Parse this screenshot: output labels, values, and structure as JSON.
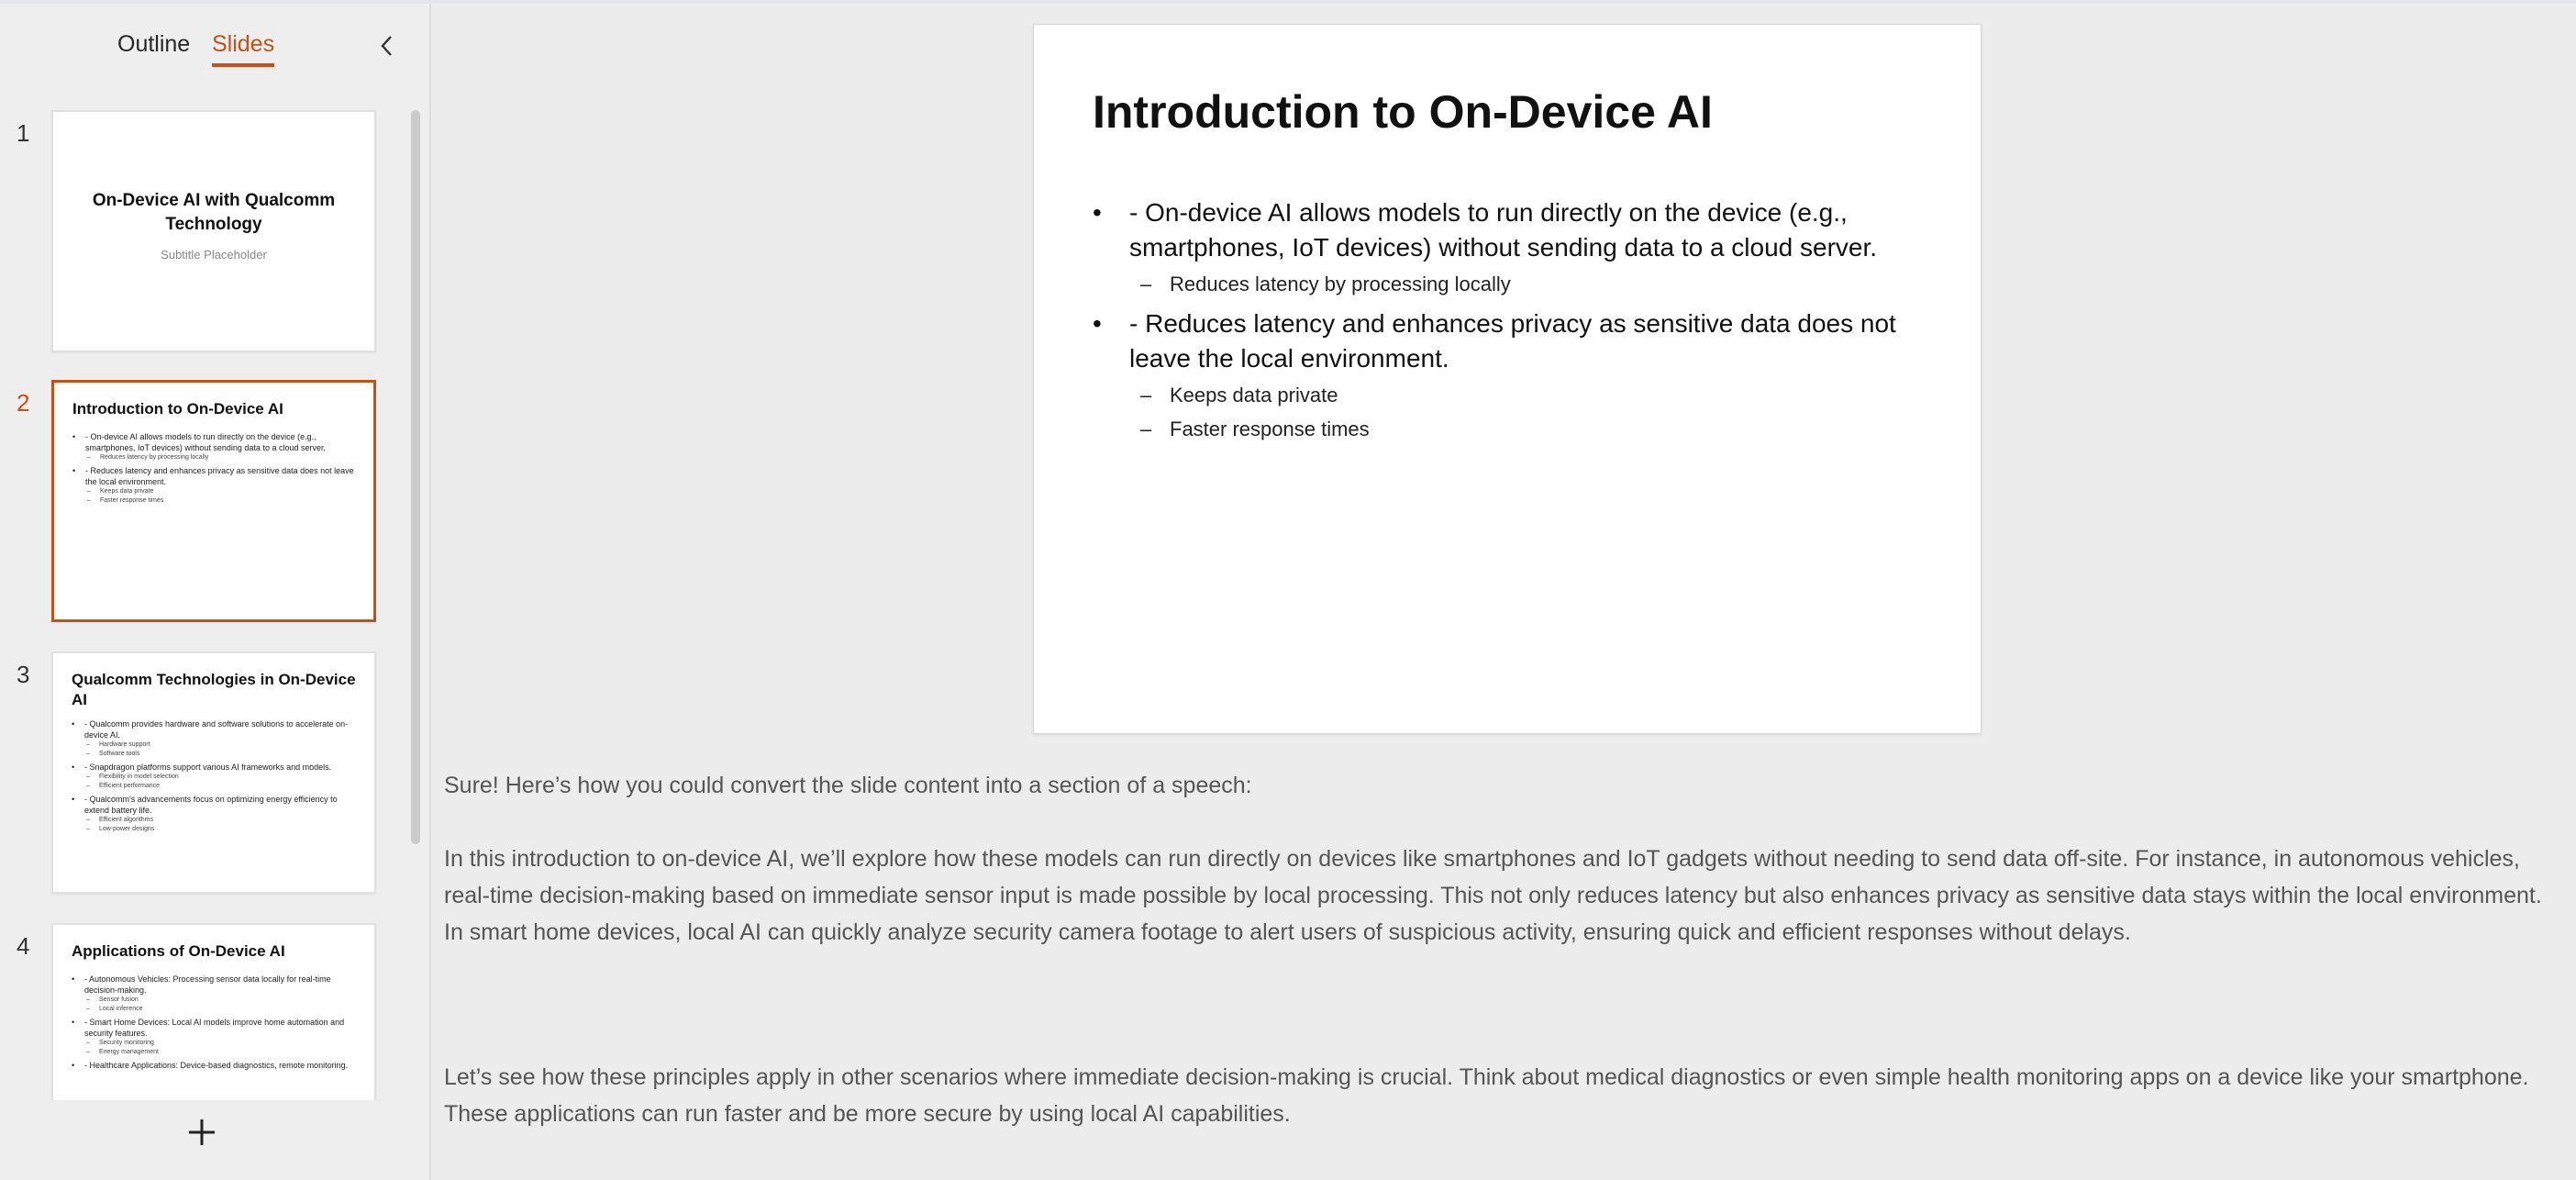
{
  "panel": {
    "tabs": [
      {
        "label": "Outline"
      },
      {
        "label": "Slides"
      }
    ]
  },
  "thumbnails": [
    {
      "num": "1",
      "title": "On-Device AI with Qualcomm Technology",
      "subtitle": "Subtitle Placeholder"
    },
    {
      "num": "2",
      "title": "Introduction to On-Device AI",
      "items": [
        {
          "type": "b",
          "text": "- On-device AI allows models to run directly on the device (e.g., smartphones, IoT devices) without sending data to a cloud server."
        },
        {
          "type": "s",
          "text": "Reduces latency by processing locally"
        },
        {
          "type": "b",
          "text": "- Reduces latency and enhances privacy as sensitive data does not leave the local environment."
        },
        {
          "type": "s",
          "text": "Keeps data private"
        },
        {
          "type": "s",
          "text": "Faster response times"
        }
      ]
    },
    {
      "num": "3",
      "title": "Qualcomm Technologies in On-Device AI",
      "items": [
        {
          "type": "b",
          "text": "- Qualcomm provides hardware and software solutions to accelerate on-device AI."
        },
        {
          "type": "s",
          "text": "Hardware support"
        },
        {
          "type": "s",
          "text": "Software tools"
        },
        {
          "type": "b",
          "text": "- Snapdragon platforms support various AI frameworks and models."
        },
        {
          "type": "s",
          "text": "Flexibility in model selection"
        },
        {
          "type": "s",
          "text": "Efficient performance"
        },
        {
          "type": "b",
          "text": "- Qualcomm's advancements focus on optimizing energy efficiency to extend battery life."
        },
        {
          "type": "s",
          "text": "Efficient algorithms"
        },
        {
          "type": "s",
          "text": "Low-power designs"
        }
      ]
    },
    {
      "num": "4",
      "title": "Applications of On-Device AI",
      "items": [
        {
          "type": "b",
          "text": "- Autonomous Vehicles: Processing sensor data locally for real-time decision-making."
        },
        {
          "type": "s",
          "text": "Sensor fusion"
        },
        {
          "type": "s",
          "text": "Local inference"
        },
        {
          "type": "b",
          "text": "- Smart Home Devices: Local AI models improve home automation and security features."
        },
        {
          "type": "s",
          "text": "Security monitoring"
        },
        {
          "type": "s",
          "text": "Energy management"
        },
        {
          "type": "b",
          "text": "- Healthcare Applications: Device-based diagnostics, remote monitoring."
        }
      ]
    }
  ],
  "slide": {
    "title": "Introduction to On-Device AI",
    "items": [
      {
        "type": "b",
        "text": "- On-device AI allows models to run directly on the device (e.g., smartphones, IoT devices) without sending data to a cloud server."
      },
      {
        "type": "s",
        "text": "Reduces latency by processing locally"
      },
      {
        "type": "b",
        "text": "- Reduces latency and enhances privacy as sensitive data does not leave the local environment."
      },
      {
        "type": "s",
        "text": "Keeps data private"
      },
      {
        "type": "s",
        "text": "Faster response times"
      }
    ]
  },
  "notes": {
    "p1": "Sure! Here’s how you could convert the slide content into a section of a speech:",
    "p2": "In this introduction to on-device AI, we’ll explore how these models can run directly on devices like smartphones and IoT gadgets without needing to send data off-site. For instance, in autonomous vehicles, real-time decision-making based on immediate sensor input is made possible by local processing. This not only reduces latency but also enhances privacy as sensitive data stays within the local environment. In smart home devices, local AI can quickly analyze security camera footage to alert users of suspicious activity, ensuring quick and efficient responses without delays.",
    "p3": "Let’s see how these principles apply in other scenarios where immediate decision-making is crucial. Think about medical diagnostics or even simple health monitoring apps on a device like your smartphone. These applications can run faster and be more secure by using local AI capabilities."
  },
  "colors": {
    "accent": "#c4501b"
  },
  "icons": {
    "collapse": "chevron-left-icon",
    "add": "plus-icon"
  }
}
